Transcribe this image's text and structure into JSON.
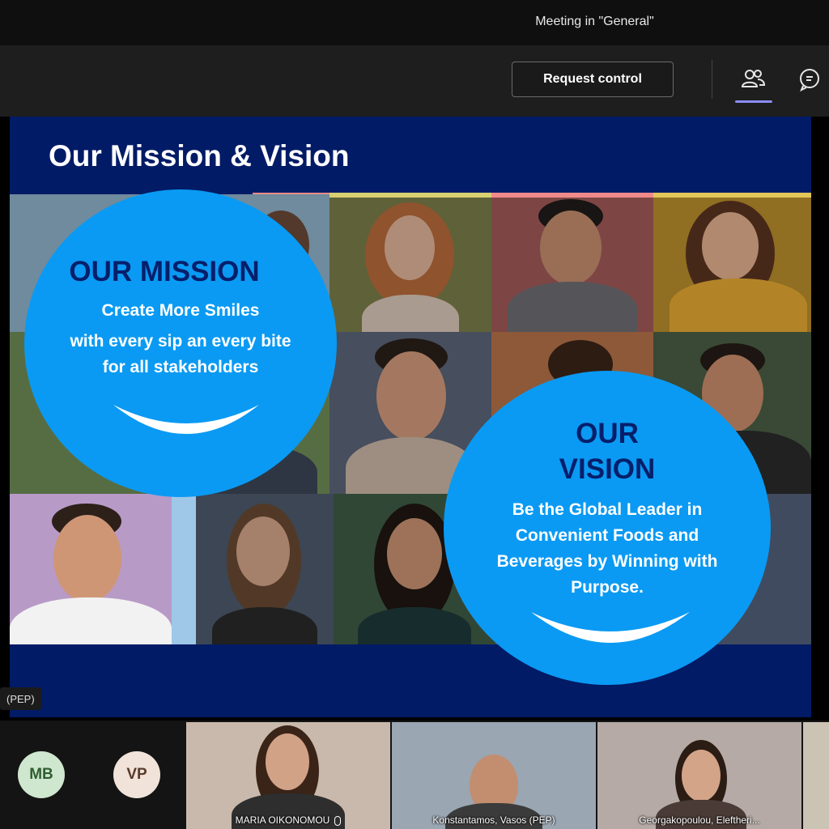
{
  "window": {
    "title": "Meeting in \"General\""
  },
  "toolbar": {
    "request_control_label": "Request control",
    "icons": [
      "people-icon",
      "chat-icon"
    ],
    "active_accent": "#8b8cf2"
  },
  "slide": {
    "title": "Our Mission & Vision",
    "background": "#021b66",
    "circle_color": "#0a9af3",
    "mission": {
      "heading": "OUR MISSION",
      "line1": "Create More Smiles",
      "line2": "with every sip an every bite",
      "line3": "for all stakeholders"
    },
    "vision": {
      "heading1": "OUR",
      "heading2": "VISION",
      "line1": "Be the Global Leader in",
      "line2": "Convenient Foods and",
      "line3": "Beverages by Winning with",
      "line4": "Purpose."
    }
  },
  "presenter_tag": "(PEP)",
  "participants": {
    "avatars": [
      {
        "initials": "MB",
        "bg": "#cfe6cf",
        "fg": "#2f5e2f"
      },
      {
        "initials": "VP",
        "bg": "#f1e3d9",
        "fg": "#5a3b2a"
      }
    ],
    "videos": [
      {
        "name": "MARIA OIKONOMOU",
        "muted_icon": "mic-icon"
      },
      {
        "name": "Konstantamos, Vasos (PEP)"
      },
      {
        "name": "Georgakopoulou, Eleftheri..."
      }
    ]
  }
}
